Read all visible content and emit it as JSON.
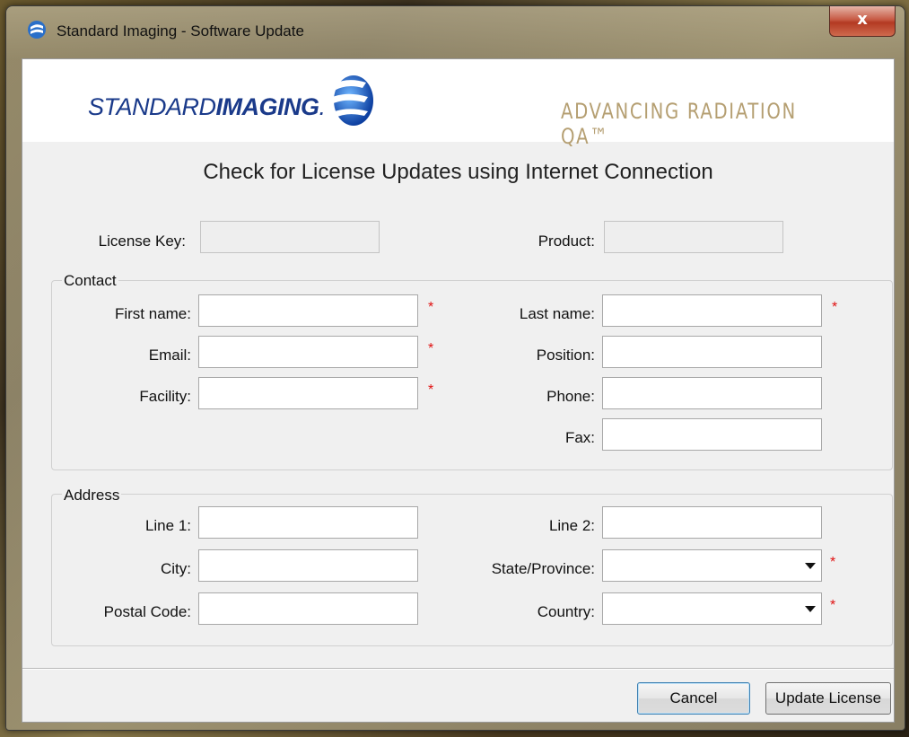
{
  "window": {
    "title": "Standard Imaging - Software Update",
    "close_label": "x"
  },
  "banner": {
    "logo_regular": "STANDARD",
    "logo_bold": "IMAGING",
    "logo_dot": ".",
    "tagline": "ADVANCING RADIATION QA™"
  },
  "heading": "Check for License Updates using Internet Connection",
  "license": {
    "license_key_label": "License Key:",
    "license_key_value": "",
    "product_label": "Product:",
    "product_value": ""
  },
  "contact": {
    "group_title": "Contact",
    "first_name_label": "First name:",
    "last_name_label": "Last name:",
    "email_label": "Email:",
    "position_label": "Position:",
    "facility_label": "Facility:",
    "phone_label": "Phone:",
    "fax_label": "Fax:",
    "first_name_value": "",
    "last_name_value": "",
    "email_value": "",
    "position_value": "",
    "facility_value": "",
    "phone_value": "",
    "fax_value": ""
  },
  "address": {
    "group_title": "Address",
    "line1_label": "Line 1:",
    "line2_label": "Line 2:",
    "city_label": "City:",
    "state_label": "State/Province:",
    "postal_label": "Postal Code:",
    "country_label": "Country:",
    "line1_value": "",
    "line2_value": "",
    "city_value": "",
    "state_value": "",
    "postal_value": "",
    "country_value": ""
  },
  "required_marker": "*",
  "buttons": {
    "cancel": "Cancel",
    "update": "Update License"
  },
  "colors": {
    "logo_blue": "#1a3a8a",
    "tagline_gold": "#b59f72",
    "required_red": "#e01010"
  }
}
